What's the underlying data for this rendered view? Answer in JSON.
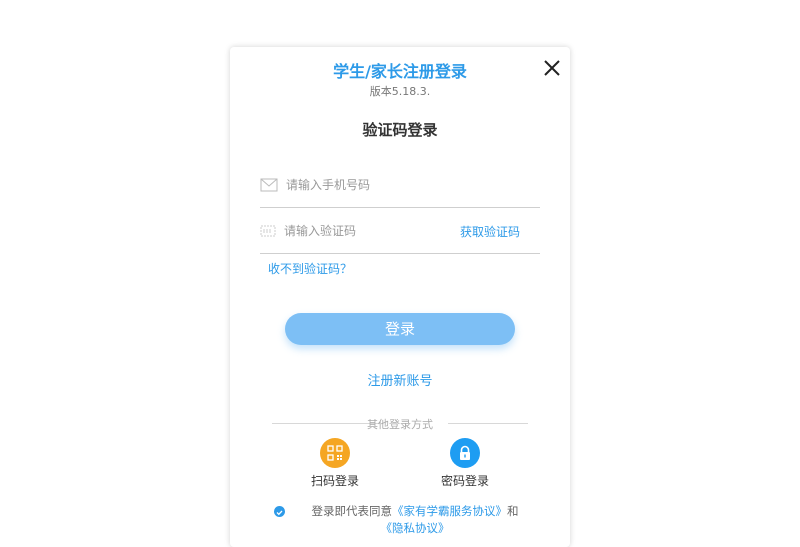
{
  "dialog": {
    "title": "学生/家长注册登录",
    "version": "版本5.18.3.",
    "heading": "验证码登录",
    "phone_placeholder": "请输入手机号码",
    "code_placeholder": "请输入验证码",
    "get_code_label": "获取验证码",
    "no_code_label": "收不到验证码？",
    "login_label": "登录",
    "register_label": "注册新账号",
    "other_methods_label": "其他登录方式",
    "alt_methods": [
      {
        "label": "扫码登录",
        "icon": "qr-code-icon",
        "color": "#f5a623"
      },
      {
        "label": "密码登录",
        "icon": "lock-icon",
        "color": "#1e9df2"
      }
    ],
    "agreement": {
      "prefix": "登录即代表同意",
      "service_link": "《家有学霸服务协议》",
      "and": "和",
      "privacy_link": "《隐私协议》"
    },
    "accent_color": "#2d9ae8"
  }
}
